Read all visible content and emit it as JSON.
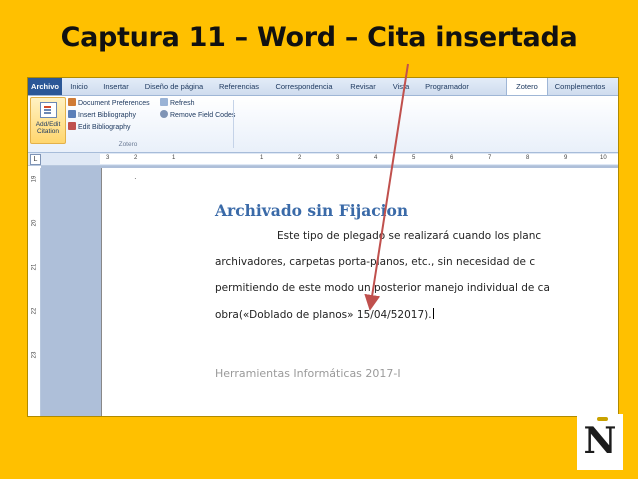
{
  "slide": {
    "title": "Captura 11 – Word – Cita insertada"
  },
  "ribbon": {
    "tabs": [
      "Archivo",
      "Inicio",
      "Insertar",
      "Diseño de página",
      "Referencias",
      "Correspondencia",
      "Revisar",
      "Vista",
      "Programador",
      "Zotero",
      "Complementos"
    ],
    "active_tab": "Zotero",
    "add_edit_citation": "Add/Edit Citation",
    "document_preferences": "Document Preferences",
    "insert_bibliography": "Insert Bibliography",
    "edit_bibliography": "Edit Bibliography",
    "refresh": "Refresh",
    "remove_field_codes": "Remove Field Codes",
    "group_label": "Zotero"
  },
  "ruler": {
    "numbers": [
      "3",
      "2",
      "1",
      "1",
      "2",
      "3",
      "4",
      "5",
      "6",
      "7",
      "8",
      "9",
      "10"
    ],
    "vnumbers": [
      "19",
      "20",
      "21",
      "22",
      "23"
    ]
  },
  "document": {
    "heading": "Archivado sin Fijacion",
    "lines": [
      "Este tipo de plegado se realizará cuando los planc",
      "archivadores, carpetas porta-planos, etc., sin necesidad de c",
      "permitiendo de este modo un posterior manejo individual de ca",
      "obra(«Doblado de planos» 15/04/52017)."
    ],
    "footer": "Herramientas Informáticas 2017-I"
  },
  "logo": {
    "letter": "N"
  },
  "colors": {
    "background": "#ffc000",
    "heading": "#3a6aa8",
    "arrow": "#c0504d"
  }
}
